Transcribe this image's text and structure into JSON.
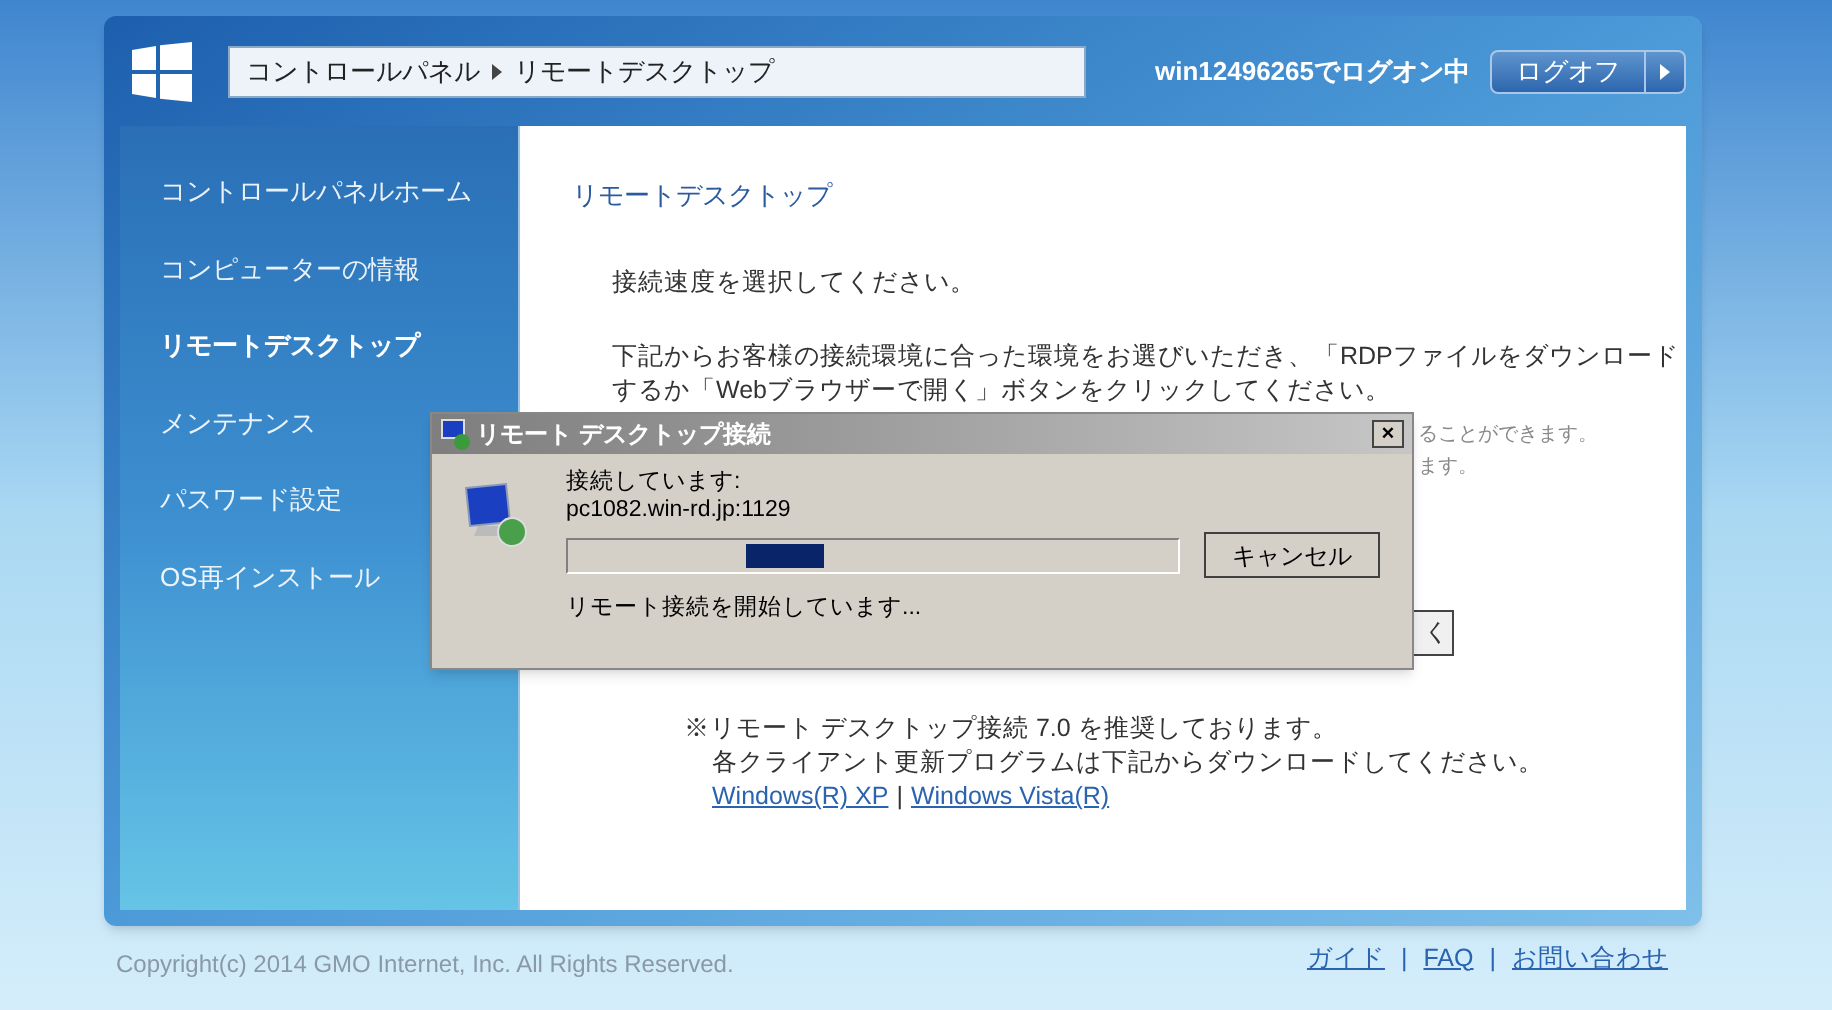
{
  "header": {
    "breadcrumb": [
      "コントロールパネル",
      "リモートデスクトップ"
    ],
    "user_status": "win12496265でログオン中",
    "logoff_button": "ログオフ"
  },
  "sidebar": {
    "items": [
      {
        "label": "コントロールパネルホーム",
        "selected": false
      },
      {
        "label": "コンピューターの情報",
        "selected": false
      },
      {
        "label": "リモートデスクトップ",
        "selected": true
      },
      {
        "label": "メンテナンス",
        "selected": false
      },
      {
        "label": "パスワード設定",
        "selected": false
      },
      {
        "label": "OS再インストール",
        "selected": false
      }
    ]
  },
  "content": {
    "heading": "リモートデスクトップ",
    "prompt": "接続速度を選択してください。",
    "intro_lines": [
      "下記からお客様の接続環境に合った環境をお選びいただき、「RDPファイルをダウンロード",
      "するか「Webブラウザーで開く」ボタンをクリックしてください。"
    ],
    "side_fragments": [
      "ることができます。",
      "ます。"
    ],
    "open_button": "く",
    "note_lines": [
      "※リモート デスクトップ接続 7.0 を推奨しております。",
      "各クライアント更新プログラムは下記からダウンロードしてください。"
    ],
    "links": [
      "Windows(R) XP",
      "Windows Vista(R)"
    ],
    "link_separator": "|"
  },
  "dialog": {
    "title": "リモート デスクトップ接続",
    "close": "×",
    "status": "接続しています:",
    "host": "pc1082.win-rd.jp:1129",
    "cancel_button": "キャンセル",
    "message": "リモート接続を開始しています..."
  },
  "footer": {
    "copyright": "Copyright(c) 2014 GMO Internet, Inc. All Rights Reserved.",
    "links": [
      "ガイド",
      "FAQ",
      "お問い合わせ"
    ],
    "link_separator": "|"
  }
}
